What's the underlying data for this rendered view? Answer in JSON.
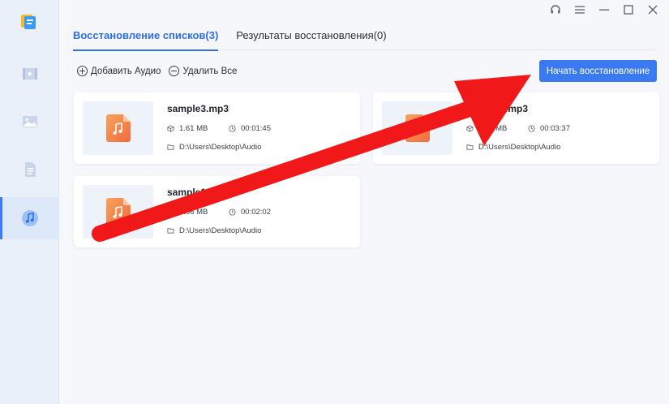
{
  "app": {
    "sidebar": {
      "logo_icon": "app-logo-icon",
      "items": [
        {
          "id": "video",
          "icon": "video-icon",
          "active": false
        },
        {
          "id": "photo",
          "icon": "photo-icon",
          "active": false
        },
        {
          "id": "document",
          "icon": "document-icon",
          "active": false
        },
        {
          "id": "audio",
          "icon": "music-note-icon",
          "active": true
        }
      ]
    },
    "window_controls": [
      "headset-icon",
      "menu-icon",
      "minimize-icon",
      "maximize-icon",
      "close-icon"
    ]
  },
  "tabs": [
    {
      "label": "Восстановление списков(3)",
      "active": true
    },
    {
      "label": "Результаты восстановления(0)",
      "active": false
    }
  ],
  "toolbar": {
    "add_label": "Добавить Аудио",
    "remove_label": "Удалить Все",
    "start_label": "Начать восстановление"
  },
  "files": [
    {
      "name": "sample3.mp3",
      "size": "1.61 MB",
      "duration": "00:01:45",
      "path": "D:\\Users\\Desktop\\Audio"
    },
    {
      "name": "sample2.mp3",
      "size": "3.32 MB",
      "duration": "00:03:37",
      "path": "D:\\Users\\Desktop\\Audio"
    },
    {
      "name": "sample1.mp3",
      "size": "1.86 MB",
      "duration": "00:02:02",
      "path": "D:\\Users\\Desktop\\Audio"
    }
  ],
  "colors": {
    "accent": "#3a7af0",
    "annotation_arrow": "#f01818",
    "audio_thumb_start": "#f7a35a",
    "audio_thumb_end": "#f26a3f"
  }
}
